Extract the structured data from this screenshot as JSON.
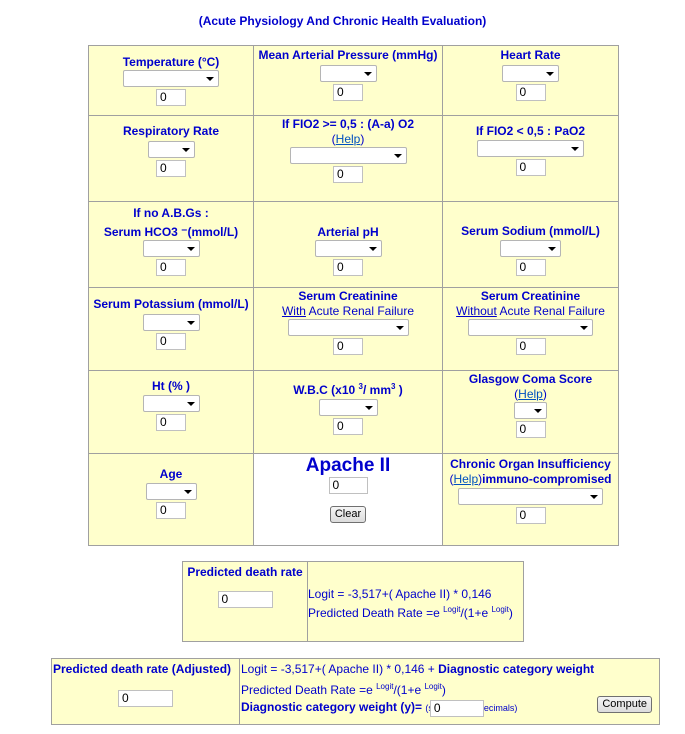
{
  "header": {
    "title": "(Acute Physiology And Chronic Health Evaluation)"
  },
  "fields": {
    "temperature": {
      "label": "Temperature (°C)",
      "selected": "",
      "value": "0"
    },
    "map": {
      "label": "Mean Arterial Pressure (mmHg)",
      "selected": "",
      "value": "0"
    },
    "heart_rate": {
      "label": "Heart Rate",
      "selected": "",
      "value": "0"
    },
    "resp_rate": {
      "label": "Respiratory Rate",
      "selected": "",
      "value": "0"
    },
    "fio2_high": {
      "label": "If FIO2 >= 0,5 : (A-a) O2",
      "help_open": "(",
      "help": "Help",
      "help_close": ")",
      "selected": "",
      "value": "0"
    },
    "fio2_low": {
      "label": "If FIO2 < 0,5 : PaO2",
      "selected": "",
      "value": "0"
    },
    "hco3": {
      "label_line1": "If no A.B.Gs :",
      "label_line2": "Serum HCO3 ⁻(mmol/L)",
      "selected": "",
      "value": "0"
    },
    "ph": {
      "label": "Arterial pH",
      "selected": "",
      "value": "0"
    },
    "sodium": {
      "label": "Serum Sodium (mmol/L)",
      "selected": "",
      "value": "0"
    },
    "potassium": {
      "label": "Serum Potassium (mmol/L)",
      "selected": "",
      "value": "0"
    },
    "creat_arf": {
      "label": "Serum Creatinine",
      "sub_u": "With",
      "sub_rest": " Acute Renal Failure",
      "selected": "",
      "value": "0"
    },
    "creat_noarf": {
      "label": "Serum Creatinine",
      "sub_u": "Without",
      "sub_rest": " Acute Renal Failure",
      "selected": "",
      "value": "0"
    },
    "ht": {
      "label": "Ht (% )",
      "selected": "",
      "value": "0"
    },
    "wbc": {
      "label_pre": "W.B.C (x10 ",
      "sup1": "3",
      "label_mid": "/ mm",
      "sup2": "3",
      "label_post": " )",
      "selected": "",
      "value": "0"
    },
    "gcs": {
      "label": "Glasgow Coma Score",
      "help_open": "(",
      "help": "Help",
      "help_close": ")",
      "selected": "",
      "value": "0"
    },
    "age": {
      "label": "Age",
      "selected": "",
      "value": "0"
    },
    "chronic": {
      "label_line1": "Chronic Organ Insufficiency",
      "help_open": "(",
      "help": "Help",
      "help_close": ")",
      "label_line2": "immuno-compromised",
      "selected": "",
      "value": "0"
    }
  },
  "apache": {
    "title": "Apache II",
    "value": "0",
    "clear_label": "Clear"
  },
  "predicted": {
    "label": "Predicted death rate",
    "value": "0",
    "formula1": "Logit = -3,517+( Apache II) * 0,146",
    "formula2_pre": "Predicted Death Rate =e ",
    "sup1": "Logit",
    "formula2_mid": "/(1+e ",
    "sup2": "Logit",
    "formula2_post": ")"
  },
  "adjusted": {
    "label": "Predicted death rate (Adjusted)",
    "value": "0",
    "formula1_pre": "Logit = -3,517+( Apache II) * 0,146 + ",
    "formula1_bold": "Diagnostic category weight",
    "formula2_pre": "Predicted Death Rate =e ",
    "sup1": "Logit",
    "formula2_mid": "/(1+e ",
    "sup2": "Logit",
    "formula2_post": ")",
    "weight_label": "Diagnostic category weight (y)= ",
    "weight_hint_pre": "(s",
    "weight_value": "0",
    "weight_hint_post": "ecimals)",
    "compute_label": "Compute"
  }
}
